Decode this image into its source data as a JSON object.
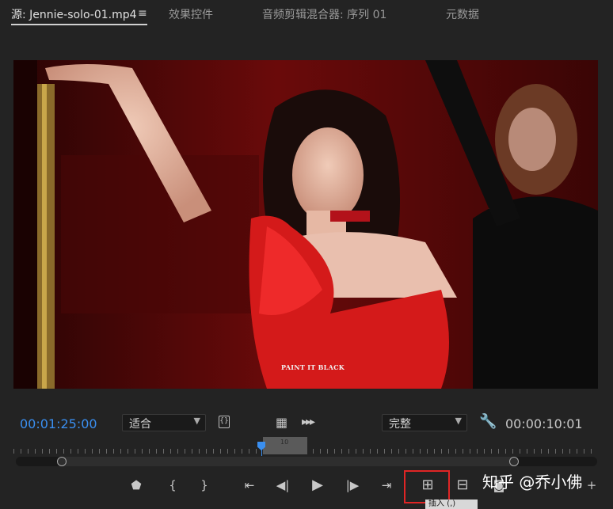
{
  "tabs": [
    {
      "label": "源: Jennie-solo-01.mp4",
      "active": true
    },
    {
      "label": "效果控件",
      "active": false
    },
    {
      "label": "音频剪辑混合器: 序列 01",
      "active": false
    },
    {
      "label": "元数据",
      "active": false
    }
  ],
  "tab_menu_glyph": "≡",
  "video": {
    "overlay_text": "PAINT IT BLACK"
  },
  "timecode": {
    "current": "00:01:25:00",
    "duration": "00:00:10:01"
  },
  "fit_select": {
    "value": "适合"
  },
  "quality_select": {
    "value": "完整"
  },
  "inout_label": "10",
  "tooltip_text": "插入 (,)",
  "watermark": "知乎 @乔小佛",
  "colors": {
    "accent": "#3a8ff0",
    "highlight": "#e02525",
    "background": "#232323"
  }
}
